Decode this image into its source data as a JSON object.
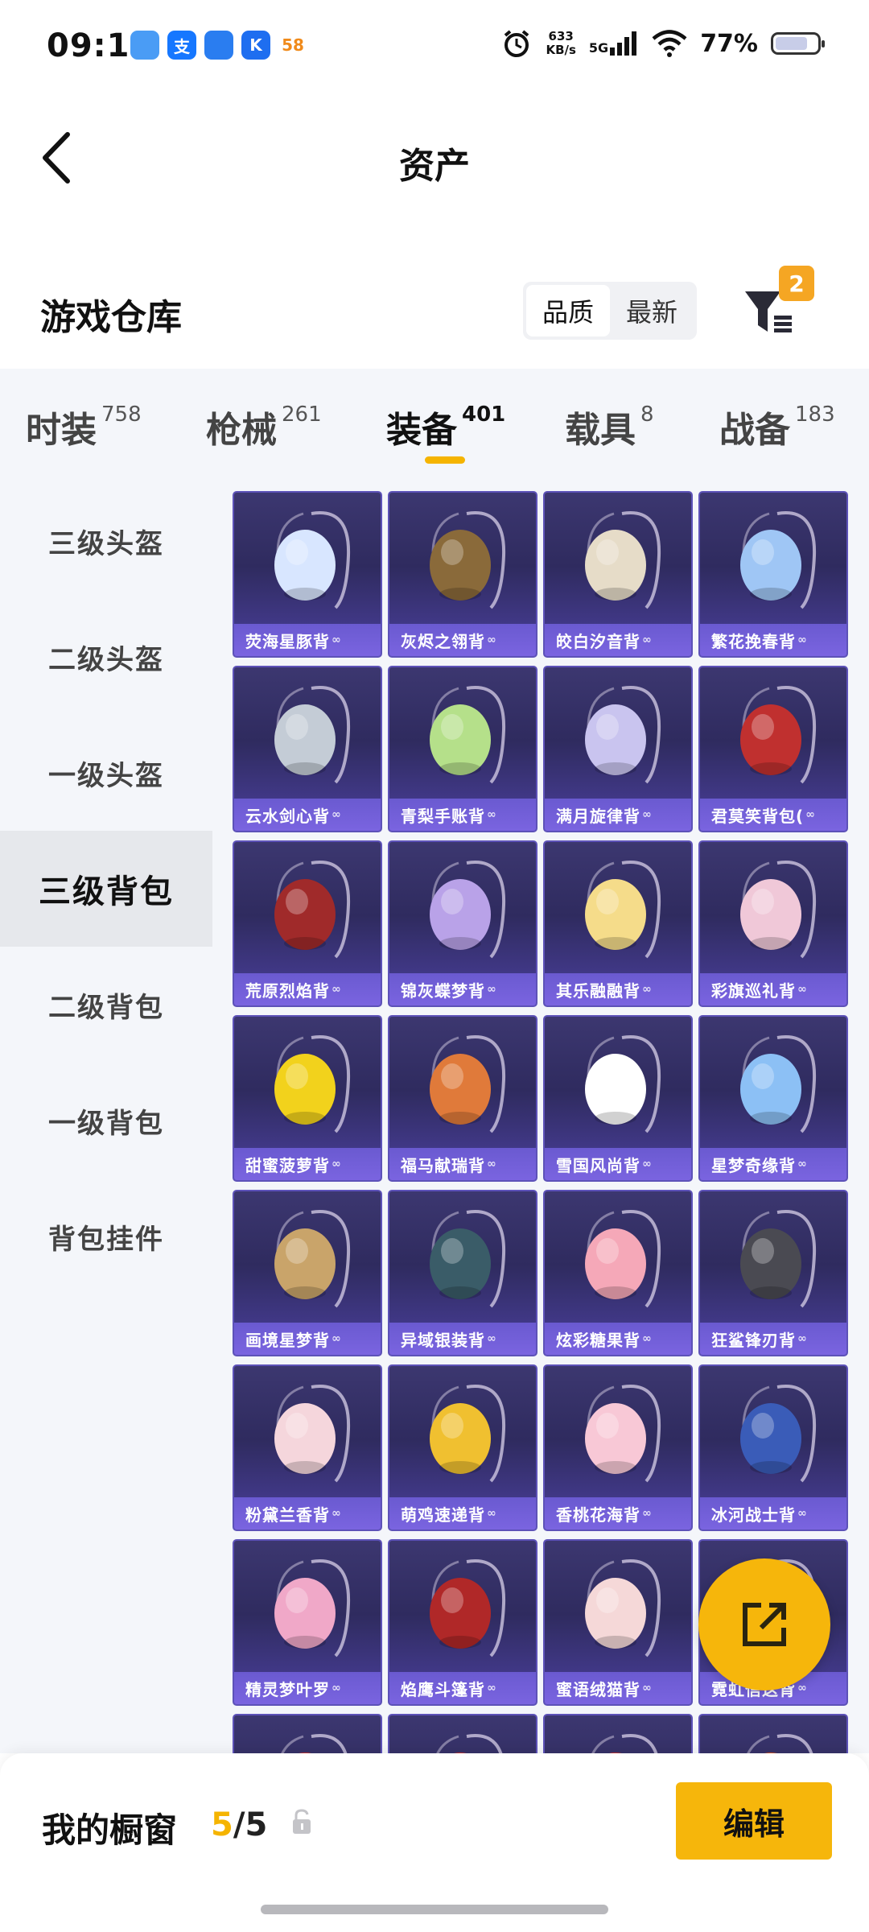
{
  "status_bar": {
    "time": "09:19",
    "apps": [
      {
        "icon": "app-icon-1",
        "color": "#4a9cf5",
        "glyph": ""
      },
      {
        "icon": "alipay-icon",
        "color": "#1677ff",
        "glyph": "支"
      },
      {
        "icon": "message-icon",
        "color": "#2a7df0",
        "glyph": ""
      },
      {
        "icon": "k-app-icon",
        "color": "#1e6ef0",
        "glyph": "K"
      },
      {
        "icon": "58-app-icon",
        "color": "#ffffff",
        "glyph": "58"
      }
    ],
    "net_speed_value": "633",
    "net_speed_unit": "KB/s",
    "network": "5G",
    "battery": "77%",
    "battery_level": 0.77
  },
  "header": {
    "title": "资产"
  },
  "warehouse": {
    "title": "游戏仓库",
    "sort_options": [
      "品质",
      "最新"
    ],
    "active_sort": 0,
    "filter_badge": "2"
  },
  "tabs": [
    {
      "label": "时装",
      "count": "758"
    },
    {
      "label": "枪械",
      "count": "261"
    },
    {
      "label": "装备",
      "count": "401"
    },
    {
      "label": "载具",
      "count": "8"
    },
    {
      "label": "战备",
      "count": "183"
    }
  ],
  "active_tab": 2,
  "sidebar": [
    {
      "label": "三级头盔"
    },
    {
      "label": "二级头盔"
    },
    {
      "label": "一级头盔"
    },
    {
      "label": "三级背包"
    },
    {
      "label": "二级背包"
    },
    {
      "label": "一级背包"
    },
    {
      "label": "背包挂件"
    }
  ],
  "active_sidebar": 3,
  "items": [
    {
      "name": "荧海星豚背",
      "color": "#d8e6ff"
    },
    {
      "name": "灰烬之翎背",
      "color": "#8a6a3a"
    },
    {
      "name": "皎白汐音背",
      "color": "#e6dcc8"
    },
    {
      "name": "繁花挽春背",
      "color": "#9fc6f5"
    },
    {
      "name": "云水剑心背",
      "color": "#c4ccd6"
    },
    {
      "name": "青梨手账背",
      "color": "#b5e08a"
    },
    {
      "name": "满月旋律背",
      "color": "#c9c4ef"
    },
    {
      "name": "君莫笑背包(",
      "color": "#c0302f"
    },
    {
      "name": "荒原烈焰背",
      "color": "#a02a2a"
    },
    {
      "name": "锦灰蝶梦背",
      "color": "#b9a2e8"
    },
    {
      "name": "其乐融融背",
      "color": "#f5dc8a"
    },
    {
      "name": "彩旗巡礼背",
      "color": "#f0c8d8"
    },
    {
      "name": "甜蜜菠萝背",
      "color": "#f2d21c"
    },
    {
      "name": "福马献瑞背",
      "color": "#e07a3a"
    },
    {
      "name": "雪国风尚背",
      "color": "#ffffff"
    },
    {
      "name": "星梦奇缘背",
      "color": "#8cc0f5"
    },
    {
      "name": "画境星梦背",
      "color": "#c9a46a"
    },
    {
      "name": "异域银装背",
      "color": "#3a5c68"
    },
    {
      "name": "炫彩糖果背",
      "color": "#f5a8b8"
    },
    {
      "name": "狂鲨锋刃背",
      "color": "#4a4a52"
    },
    {
      "name": "粉黛兰香背",
      "color": "#f5d6dc"
    },
    {
      "name": "萌鸡速递背",
      "color": "#f0c030"
    },
    {
      "name": "香桃花海背",
      "color": "#f8c8d6"
    },
    {
      "name": "冰河战士背",
      "color": "#3a5cb8"
    },
    {
      "name": "精灵梦叶罗",
      "color": "#f0a8c8"
    },
    {
      "name": "焰鹰斗篷背",
      "color": "#b02828"
    },
    {
      "name": "蜜语绒猫背",
      "color": "#f5d8d8"
    },
    {
      "name": "霓虹信这背",
      "color": "#2a2a40"
    },
    {
      "name": "",
      "color": "#c03030"
    },
    {
      "name": "",
      "color": "#c03030"
    },
    {
      "name": "",
      "color": "#c03030"
    },
    {
      "name": "",
      "color": "#d05020"
    }
  ],
  "showcase": {
    "label": "我的橱窗",
    "used": "5",
    "separator": "/",
    "total": "5"
  },
  "edit_button": "编辑"
}
